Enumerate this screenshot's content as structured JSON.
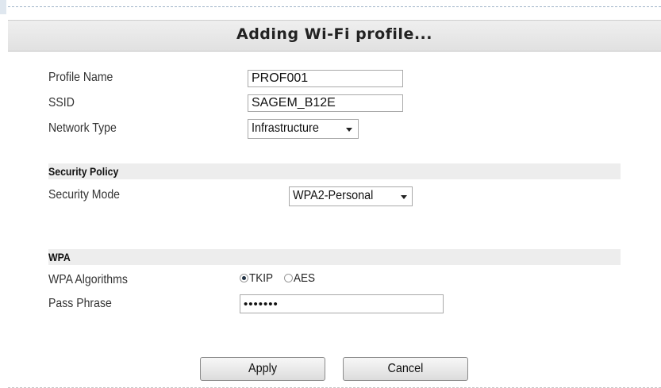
{
  "title": "Adding Wi-Fi profile...",
  "profile_name": {
    "label": "Profile Name",
    "value": "PROF001"
  },
  "ssid": {
    "label": "SSID",
    "value": "SAGEM_B12E"
  },
  "network_type": {
    "label": "Network Type",
    "value": "Infrastructure"
  },
  "security_policy": {
    "section_title": "Security Policy",
    "mode_label": "Security Mode",
    "mode_value": "WPA2-Personal"
  },
  "wpa": {
    "section_title": "WPA",
    "algorithms_label": "WPA Algorithms",
    "algorithms": [
      {
        "label": "TKIP",
        "selected": true
      },
      {
        "label": "AES",
        "selected": false
      }
    ],
    "pass_phrase_label": "Pass Phrase",
    "pass_phrase_value": "•••••••"
  },
  "buttons": {
    "apply": "Apply",
    "cancel": "Cancel"
  }
}
